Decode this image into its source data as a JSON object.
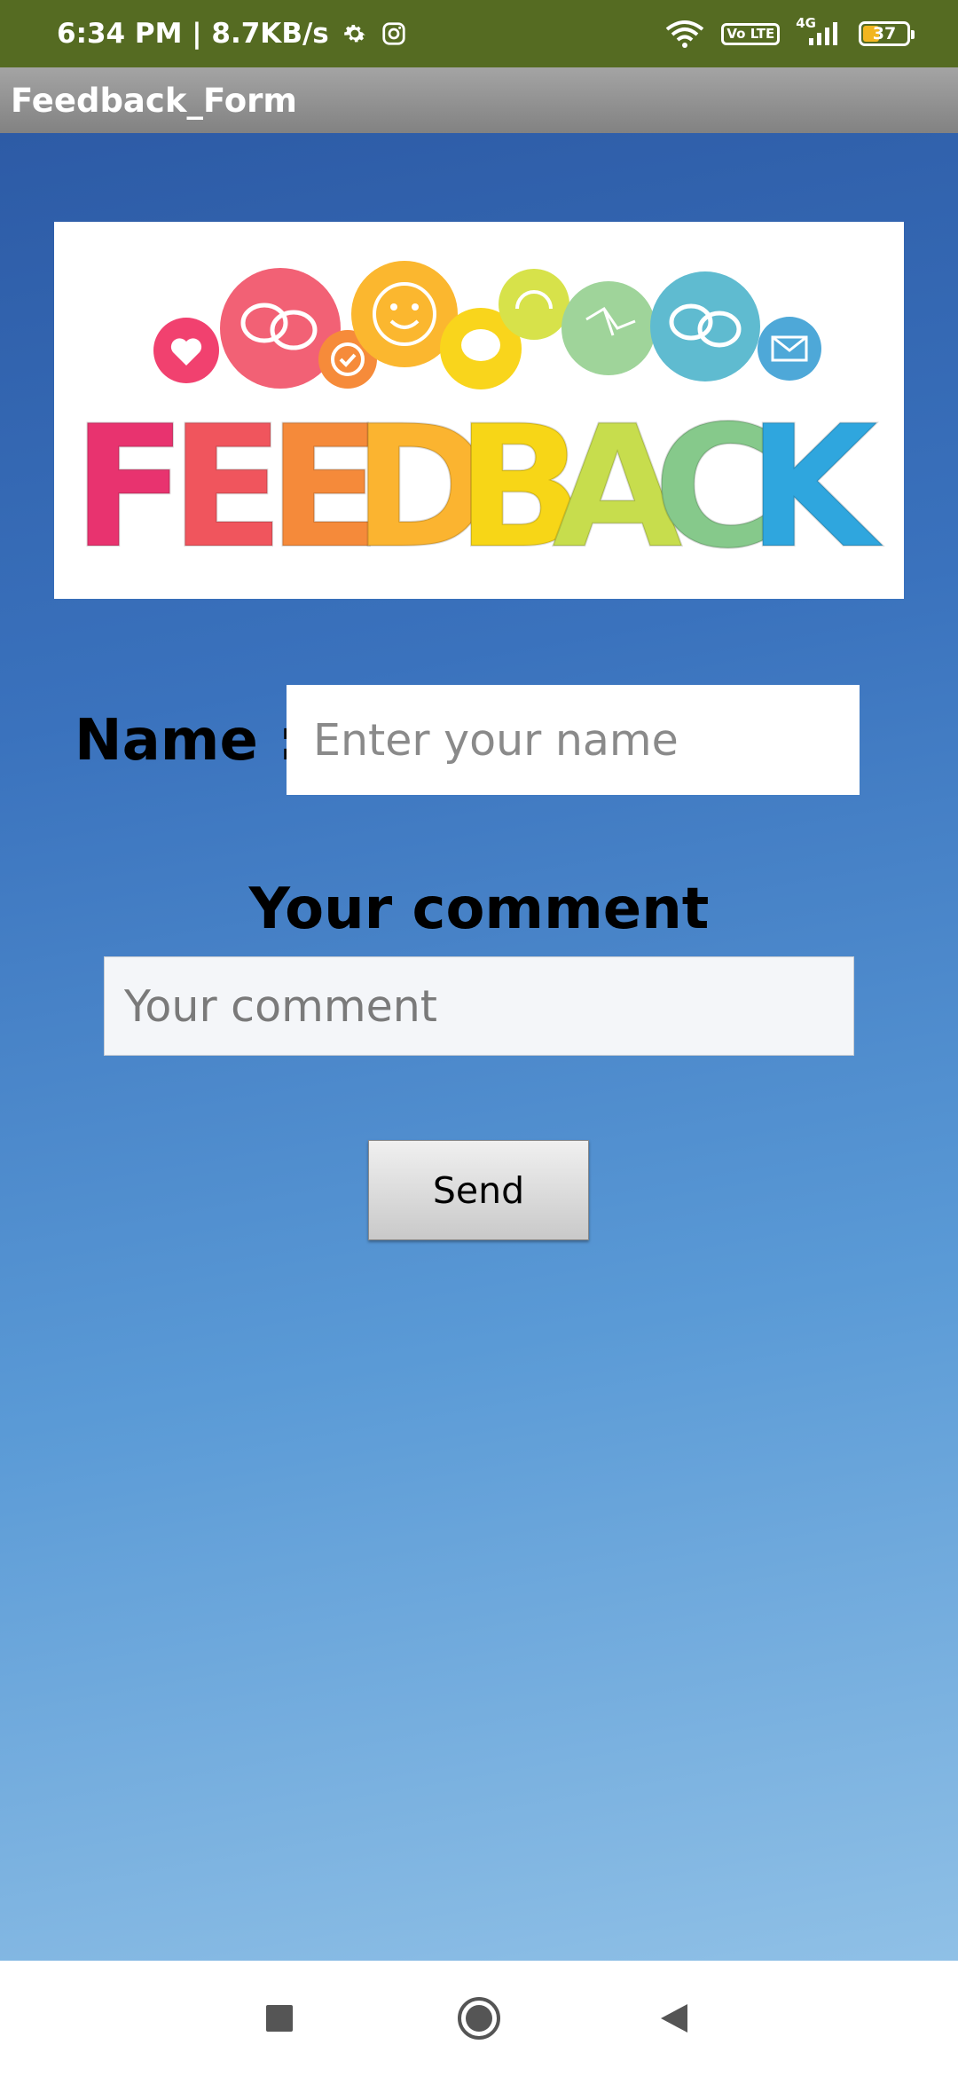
{
  "status_bar": {
    "time_speed": "6:34 PM | 8.7KB/s",
    "network_type": "4G",
    "volte": "Vo LTE",
    "battery_level": "37",
    "battery_fraction": 0.37,
    "icons": [
      "settings-icon",
      "instagram-icon",
      "wifi-icon",
      "volte-icon",
      "signal-icon",
      "battery-icon"
    ]
  },
  "app": {
    "title": "Feedback_Form"
  },
  "banner": {
    "word": "FEEDBACK",
    "letters": [
      "F",
      "E",
      "E",
      "D",
      "B",
      "A",
      "C",
      "K"
    ],
    "letter_colors": [
      "#e8336f",
      "#f0555d",
      "#f58a3a",
      "#fbb430",
      "#f7d617",
      "#c7dd4d",
      "#86c98b",
      "#2fa6de"
    ],
    "bubble_icons": [
      "heart-icon",
      "chat-icon",
      "check-badge-icon",
      "smiley-icon",
      "speech-icon",
      "headset-icon",
      "network-icon",
      "chat-icon",
      "mail-icon"
    ]
  },
  "form": {
    "name_label": "Name :",
    "name_placeholder": "Enter your name",
    "name_value": "",
    "comment_title": "Your comment",
    "comment_placeholder": "Your comment",
    "comment_value": "",
    "send_label": "Send"
  },
  "nav_bar": {
    "icons": [
      "recents-square-icon",
      "home-circle-icon",
      "back-triangle-icon"
    ]
  },
  "colors": {
    "status_bar": "#556b22",
    "title_bar": "#959595",
    "background_top": "#2d5ba6",
    "background_bottom": "#8fc0e6"
  }
}
